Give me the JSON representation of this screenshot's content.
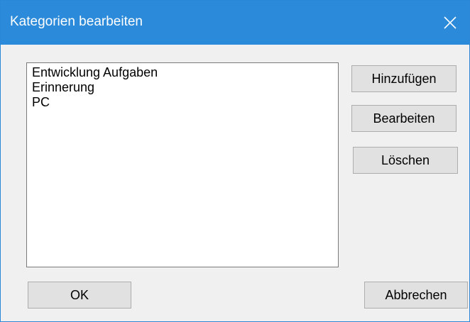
{
  "window": {
    "title": "Kategorien bearbeiten",
    "close_icon": "close-icon"
  },
  "categories": {
    "items": [
      {
        "label": "Entwicklung Aufgaben"
      },
      {
        "label": "Erinnerung"
      },
      {
        "label": "PC"
      }
    ]
  },
  "buttons": {
    "add_label": "Hinzufügen",
    "edit_label": "Bearbeiten",
    "delete_label": "Löschen",
    "ok_label": "OK",
    "cancel_label": "Abbrechen"
  },
  "colors": {
    "titlebar": "#2b8ad9",
    "dialog_background": "#f0f0f0",
    "button_background": "#e1e1e1"
  }
}
